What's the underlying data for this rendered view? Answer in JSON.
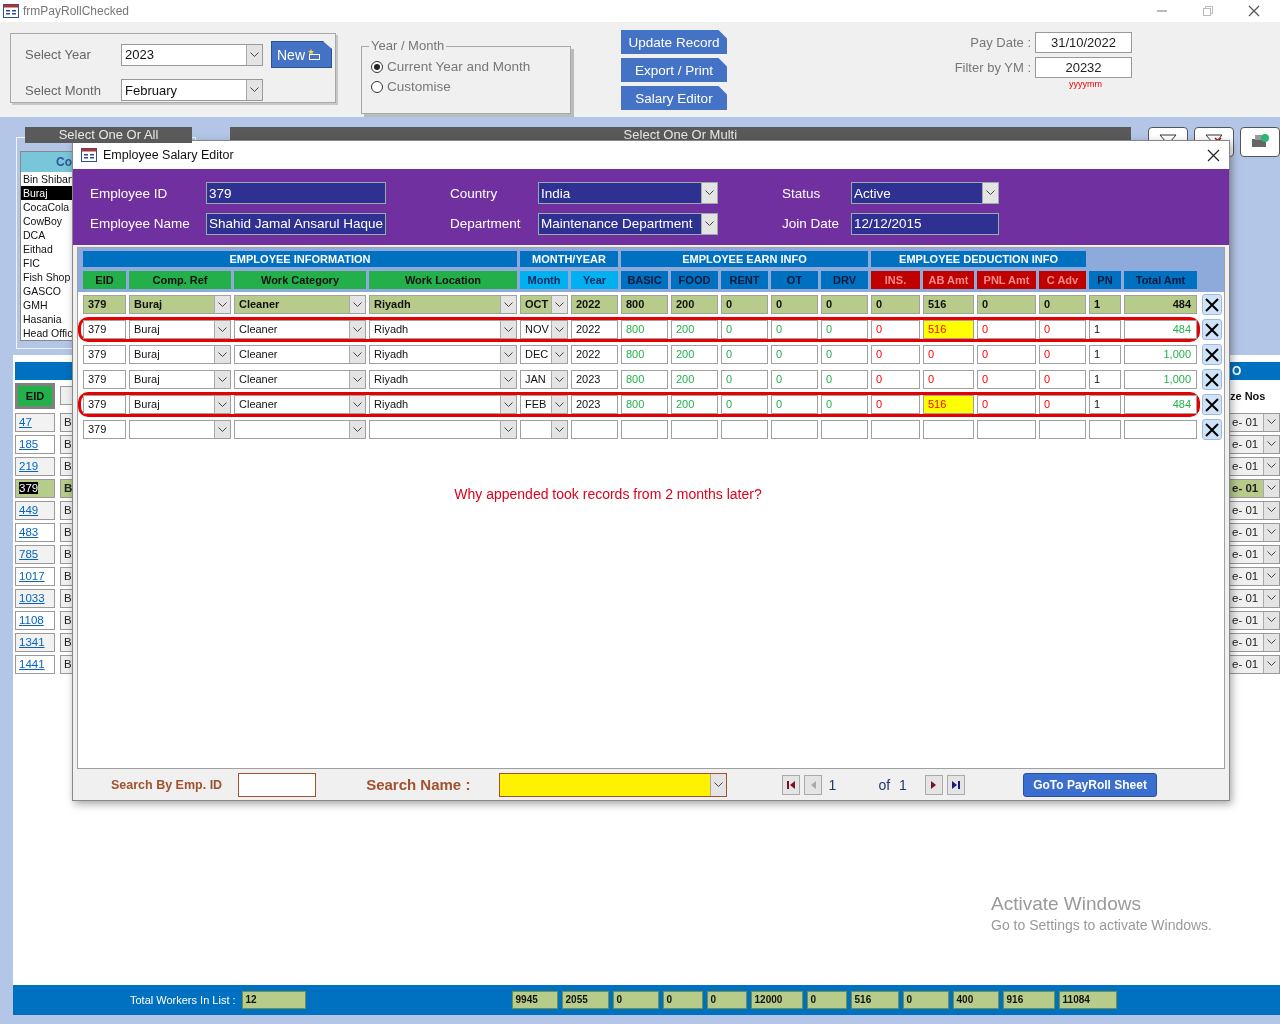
{
  "window": {
    "title": "frmPayRollChecked"
  },
  "filters": {
    "year_label": "Select Year",
    "year": "2023",
    "month_label": "Select Month",
    "month": "February",
    "new_button": "New"
  },
  "year_month": {
    "legend": "Year / Month",
    "options": [
      {
        "label": "Current Year and Month",
        "selected": true
      },
      {
        "label": "Customise",
        "selected": false
      }
    ]
  },
  "actions": [
    "Update Record",
    "Export / Print",
    "Salary Editor"
  ],
  "pay_date": {
    "label": "Pay Date :",
    "value": "31/10/2022"
  },
  "filter_ym": {
    "label": "Filter by YM :",
    "value": "20232",
    "hint": "yyyymm"
  },
  "company_panel": {
    "title": "Select One Or All",
    "heading": "Co",
    "items": [
      {
        "label": "Bin Shiban",
        "selected": false
      },
      {
        "label": "Buraj",
        "selected": true
      },
      {
        "label": "CocaCola",
        "selected": false
      },
      {
        "label": "CowBoy",
        "selected": false
      },
      {
        "label": "DCA",
        "selected": false
      },
      {
        "label": "Eithad",
        "selected": false
      },
      {
        "label": "FIC",
        "selected": false
      },
      {
        "label": "Fish Shop",
        "selected": false
      },
      {
        "label": "GASCO",
        "selected": false
      },
      {
        "label": "GMH",
        "selected": false
      },
      {
        "label": "Hasania",
        "selected": false
      },
      {
        "label": "Head Offic",
        "selected": false
      }
    ]
  },
  "multi_panel": {
    "title": "Select One Or Multi"
  },
  "workers": {
    "heading": "O",
    "eid_heading": "EID",
    "last_heading": "ze Nos",
    "rows": [
      {
        "eid": "47",
        "company": "B",
        "group": "e- 01",
        "selected": false
      },
      {
        "eid": "185",
        "company": "B",
        "group": "e- 01",
        "selected": false
      },
      {
        "eid": "219",
        "company": "B",
        "group": "e- 01",
        "selected": false
      },
      {
        "eid": "379",
        "company": "B",
        "group": "e- 01",
        "selected": true
      },
      {
        "eid": "449",
        "company": "B",
        "group": "e- 01",
        "selected": false
      },
      {
        "eid": "483",
        "company": "B",
        "group": "e- 01",
        "selected": false
      },
      {
        "eid": "785",
        "company": "B",
        "group": "e- 01",
        "selected": false
      },
      {
        "eid": "1017",
        "company": "B",
        "group": "e- 01",
        "selected": false
      },
      {
        "eid": "1033",
        "company": "B",
        "group": "e- 01",
        "selected": false
      },
      {
        "eid": "1108",
        "company": "B",
        "group": "e- 01",
        "selected": false
      },
      {
        "eid": "1341",
        "company": "B",
        "group": "e- 01",
        "selected": false
      },
      {
        "eid": "1441",
        "company": "B",
        "group": "e- 01",
        "selected": false
      }
    ]
  },
  "totals": {
    "label": "Total Workers In List :",
    "count": "12",
    "values": [
      "9945",
      "2055",
      "0",
      "0",
      "0",
      "12000",
      "0",
      "516",
      "0",
      "400",
      "916",
      "11084"
    ]
  },
  "os_notice": {
    "title": "Activate Windows",
    "text": "Go to Settings to activate Windows."
  },
  "editor": {
    "title": "Employee Salary Editor",
    "fields": [
      {
        "label": "Employee ID",
        "value": "379",
        "kind": "text"
      },
      {
        "label": "Country",
        "value": "India",
        "kind": "combo"
      },
      {
        "label": "Status",
        "value": "Active",
        "kind": "combo"
      },
      {
        "label": "Employee Name",
        "value": "Shahid Jamal Ansarul Haque",
        "kind": "text"
      },
      {
        "label": "Department",
        "value": "Maintenance Department",
        "kind": "combo"
      },
      {
        "label": "Join Date",
        "value": "12/12/2015",
        "kind": "text"
      }
    ],
    "groups": [
      {
        "label": "EMPLOYEE INFORMATION",
        "columns": [
          {
            "label": "EID",
            "kind": "info",
            "combo": false
          },
          {
            "label": "Comp. Ref",
            "kind": "info",
            "combo": true
          },
          {
            "label": "Work Category",
            "kind": "info",
            "combo": true
          },
          {
            "label": "Work Location",
            "kind": "info",
            "combo": true
          }
        ]
      },
      {
        "label": "MONTH/YEAR",
        "columns": [
          {
            "label": "Month",
            "kind": "date",
            "combo": true
          },
          {
            "label": "Year",
            "kind": "date",
            "combo": false
          }
        ]
      },
      {
        "label": "EMPLOYEE EARN INFO",
        "columns": [
          {
            "label": "BASIC",
            "kind": "earn",
            "combo": false
          },
          {
            "label": "FOOD",
            "kind": "earn",
            "combo": false
          },
          {
            "label": "RENT",
            "kind": "earn",
            "combo": false
          },
          {
            "label": "OT",
            "kind": "earn",
            "combo": false
          },
          {
            "label": "DRV",
            "kind": "earn",
            "combo": false
          }
        ]
      },
      {
        "label": "EMPLOYEE DEDUCTION INFO",
        "columns": [
          {
            "label": "INS.",
            "kind": "deduct",
            "combo": false
          },
          {
            "label": "AB Amt",
            "kind": "deduct",
            "combo": false
          },
          {
            "label": "PNL Amt",
            "kind": "deduct",
            "combo": false
          },
          {
            "label": "C Adv",
            "kind": "deduct",
            "combo": false
          }
        ]
      },
      {
        "columns": [
          {
            "label": "PN",
            "kind": "count",
            "combo": false
          },
          {
            "label": "Total Amt",
            "kind": "total",
            "combo": false
          }
        ]
      }
    ],
    "rows": [
      {
        "kind": "current",
        "circled": false,
        "values": [
          "379",
          "Buraj",
          "Cleaner",
          "Riyadh",
          "OCT",
          "2022",
          "800",
          "200",
          "0",
          "0",
          "0",
          "0",
          "516",
          "0",
          "0",
          "1",
          "484"
        ]
      },
      {
        "kind": "record",
        "circled": true,
        "values": [
          "379",
          "Buraj",
          "Cleaner",
          "Riyadh",
          "NOV",
          "2022",
          "800",
          "200",
          "0",
          "0",
          "0",
          "0",
          {
            "text": "516",
            "flagged": true
          },
          "0",
          "0",
          "1",
          "484"
        ]
      },
      {
        "kind": "record",
        "circled": false,
        "values": [
          "379",
          "Buraj",
          "Cleaner",
          "Riyadh",
          "DEC",
          "2022",
          "800",
          "200",
          "0",
          "0",
          "0",
          "0",
          "0",
          "0",
          "0",
          "1",
          "1,000"
        ]
      },
      {
        "kind": "record",
        "circled": false,
        "values": [
          "379",
          "Buraj",
          "Cleaner",
          "Riyadh",
          "JAN",
          "2023",
          "800",
          "200",
          "0",
          "0",
          "0",
          "0",
          "0",
          "0",
          "0",
          "1",
          "1,000"
        ]
      },
      {
        "kind": "record",
        "circled": true,
        "values": [
          "379",
          "Buraj",
          "Cleaner",
          "Riyadh",
          "FEB",
          "2023",
          "800",
          "200",
          "0",
          "0",
          "0",
          "0",
          {
            "text": "516",
            "flagged": true
          },
          "0",
          "0",
          "1",
          "484"
        ]
      },
      {
        "kind": "new",
        "circled": false,
        "values": [
          "379"
        ]
      }
    ],
    "note": "Why appended took records from 2 months later?",
    "footer": {
      "emp_search_label": "Search By Emp. ID",
      "name_search_label": "Search Name :",
      "record": "1",
      "of": "of",
      "total": "1",
      "goto_button": "GoTo PayRoll Sheet"
    }
  }
}
